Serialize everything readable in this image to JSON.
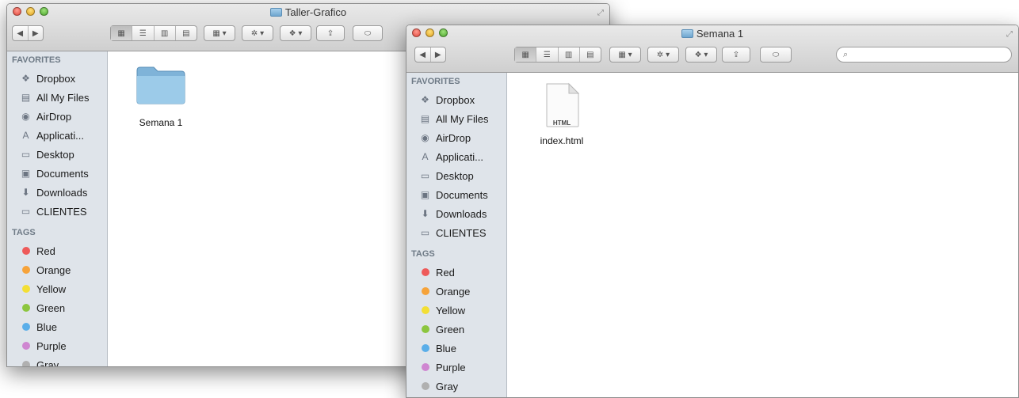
{
  "windows": [
    {
      "title": "Taller-Grafico",
      "sidebar": {
        "favorites_title": "FAVORITES",
        "favorites": [
          {
            "label": "Dropbox",
            "icon": "dropbox-icon"
          },
          {
            "label": "All My Files",
            "icon": "all-files-icon"
          },
          {
            "label": "AirDrop",
            "icon": "airdrop-icon"
          },
          {
            "label": "Applicati...",
            "icon": "applications-icon"
          },
          {
            "label": "Desktop",
            "icon": "desktop-icon"
          },
          {
            "label": "Documents",
            "icon": "documents-icon"
          },
          {
            "label": "Downloads",
            "icon": "downloads-icon"
          },
          {
            "label": "CLIENTES",
            "icon": "folder-icon"
          }
        ],
        "tags_title": "TAGS",
        "tags": [
          {
            "label": "Red",
            "color": "#ee5a5a"
          },
          {
            "label": "Orange",
            "color": "#f6a33a"
          },
          {
            "label": "Yellow",
            "color": "#f3df35"
          },
          {
            "label": "Green",
            "color": "#8cc63f"
          },
          {
            "label": "Blue",
            "color": "#5aaee9"
          },
          {
            "label": "Purple",
            "color": "#cf86d1"
          },
          {
            "label": "Gray",
            "color": "#b0b0b0"
          }
        ]
      },
      "files": [
        {
          "name": "Semana 1",
          "kind": "folder"
        }
      ]
    },
    {
      "title": "Semana 1",
      "search_placeholder": "",
      "sidebar": {
        "favorites_title": "FAVORITES",
        "favorites": [
          {
            "label": "Dropbox",
            "icon": "dropbox-icon"
          },
          {
            "label": "All My Files",
            "icon": "all-files-icon"
          },
          {
            "label": "AirDrop",
            "icon": "airdrop-icon"
          },
          {
            "label": "Applicati...",
            "icon": "applications-icon"
          },
          {
            "label": "Desktop",
            "icon": "desktop-icon"
          },
          {
            "label": "Documents",
            "icon": "documents-icon"
          },
          {
            "label": "Downloads",
            "icon": "downloads-icon"
          },
          {
            "label": "CLIENTES",
            "icon": "folder-icon"
          }
        ],
        "tags_title": "TAGS",
        "tags": [
          {
            "label": "Red",
            "color": "#ee5a5a"
          },
          {
            "label": "Orange",
            "color": "#f6a33a"
          },
          {
            "label": "Yellow",
            "color": "#f3df35"
          },
          {
            "label": "Green",
            "color": "#8cc63f"
          },
          {
            "label": "Blue",
            "color": "#5aaee9"
          },
          {
            "label": "Purple",
            "color": "#cf86d1"
          },
          {
            "label": "Gray",
            "color": "#b0b0b0"
          }
        ]
      },
      "files": [
        {
          "name": "index.html",
          "kind": "html",
          "badge": "HTML"
        }
      ]
    }
  ]
}
